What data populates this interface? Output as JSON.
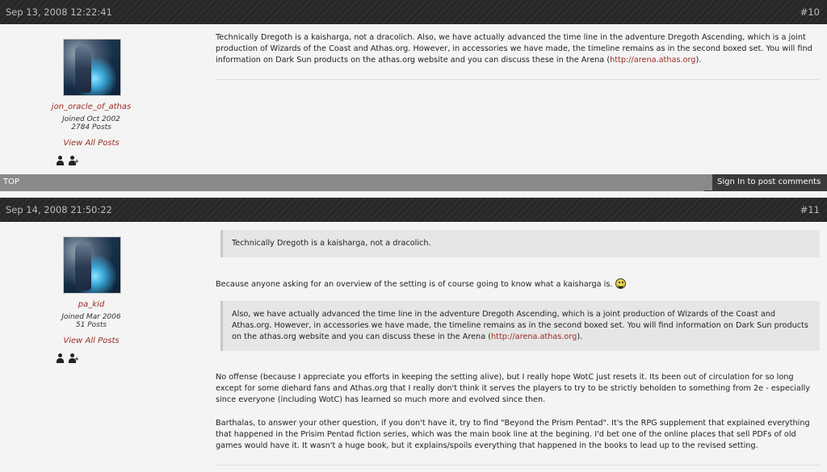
{
  "posts": [
    {
      "date": "Sep 13, 2008 12:22:41",
      "number": "#10",
      "author": {
        "username": "jon_oracle_of_athas",
        "joined": "Joined Oct 2002",
        "post_count": "2784 Posts",
        "view_all": "View All Posts"
      },
      "body": {
        "text": "Technically Dregoth is a kaisharga, not a dracolich. Also, we have actually advanced the time line in the adventure Dregoth Ascending, which is a joint production of Wizards of the Coast and Athas.org. However, in accessories we have made, the timeline remains as in the second boxed set. You will find information on Dark Sun products on the athas.org website and you can discuss these in the Arena (",
        "link": "http://arena.athas.org",
        "suffix": ")."
      }
    },
    {
      "date": "Sep 14, 2008 21:50:22",
      "number": "#11",
      "author": {
        "username": "pa_kid",
        "joined": "Joined Mar 2006",
        "post_count": "51 Posts",
        "view_all": "View All Posts"
      },
      "quote1": "Technically Dregoth is a kaisharga, not a dracolich.",
      "reply1": "Because anyone asking for an overview of the setting is of course going to know what a kaisharga is.",
      "quote2": {
        "text": "Also, we have actually advanced the time line in the adventure Dregoth Ascending, which is a joint production of Wizards of the Coast and Athas.org. However, in accessories we have made, the timeline remains as in the second boxed set. You will find information on Dark Sun products on the athas.org website and you can discuss these in the Arena (",
        "link": "http://arena.athas.org",
        "suffix": ")."
      },
      "reply2": "No offense (because I appreciate you efforts in keeping the setting alive), but I really hope WotC just resets it. Its been out of circulation for so long except for some diehard fans and Athas.org that I really don't think it serves the players to try to be strictly beholden to something from 2e - especially since everyone (including WotC) has learned so much more and evolved since then.",
      "reply3": "Barthalas, to answer your other question, if you don't have it, try to find \"Beyond the Prism Pentad\". It's the RPG supplement that explained everything that happened in the Prisim Pentad fiction series, which was the main book line at the begining. I'd bet one of the online places that sell PDFs of old games would have it. It wasn't a huge book, but it explains/spoils everything that happened in the books to lead up to the revised setting."
    }
  ],
  "bar": {
    "top_label": "TOP",
    "signin_label": "Sign In to post comments"
  },
  "icons": {
    "profile": "user-icon",
    "add_friend": "add-user-icon",
    "smiley": "smiley-icon"
  }
}
